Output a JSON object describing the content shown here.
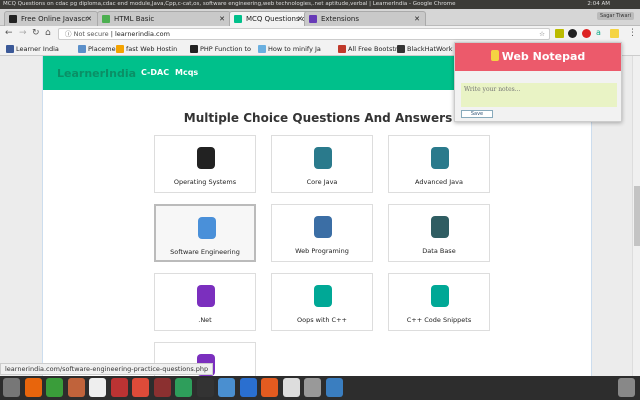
{
  "window_title": "MCQ Questions on cdac pg diploma,cdac end module,Java,Cpp,c-cat,os, software engineering,web technologies,.net aptitude,verbal | LearnerIndia - Google Chrome",
  "clock": "2:04 AM",
  "profile": "Sagar Tiwari",
  "tabs": [
    {
      "label": "Free Online Javascr",
      "color": "#222"
    },
    {
      "label": "HTML Basic",
      "color": "#4caf50"
    },
    {
      "label": "MCQ Questions on",
      "color": "#00c08b"
    },
    {
      "label": "Extensions",
      "color": "#673ab7"
    }
  ],
  "address": {
    "security": "Not secure",
    "url": "learnerindia.com"
  },
  "bookmarks": [
    {
      "label": "Learner India",
      "color": "#3b5998"
    },
    {
      "label": "Placement",
      "color": "#5b8fc9"
    },
    {
      "label": "fast Web Hostin",
      "color": "#f4a300"
    },
    {
      "label": "PHP Function to",
      "color": "#222"
    },
    {
      "label": "How to minify Ja",
      "color": "#6ab0e0"
    },
    {
      "label": "All Free Bootstra",
      "color": "#c0392b"
    },
    {
      "label": "BlackHatWork",
      "color": "#333"
    }
  ],
  "site": {
    "logo": "LearnerIndia",
    "menu": [
      "C-DAC",
      "Mcqs"
    ],
    "heading": "Multiple Choice Questions And Answers"
  },
  "cards": [
    {
      "label": "Operating Systems",
      "icon": "linux-icon",
      "color": "#222"
    },
    {
      "label": "Core Java",
      "icon": "java-icon",
      "color": "#2a7a8c"
    },
    {
      "label": "Advanced Java",
      "icon": "java-icon",
      "color": "#2a7a8c"
    },
    {
      "label": "Software Engineering",
      "icon": "software-engineering-icon",
      "color": "#4a90d9"
    },
    {
      "label": "Web Programing",
      "icon": "web-programming-icon",
      "color": "#3b6ea5"
    },
    {
      "label": "Data Base",
      "icon": "database-icon",
      "color": "#2f5d62"
    },
    {
      "label": ".Net",
      "icon": "visual-studio-icon",
      "color": "#7b2fbe"
    },
    {
      "label": "Oops with C++",
      "icon": "cpp-icon",
      "color": "#00a896"
    },
    {
      "label": "C++ Code Snippets",
      "icon": "cpp-icon",
      "color": "#00a896"
    },
    {
      "label": "",
      "icon": "csharp-icon",
      "color": "#7b2fbe"
    }
  ],
  "status_url": "learnerindia.com/software-engineering-practice-questions.php",
  "notepad": {
    "title": "Web Notepad",
    "placeholder": "Write your notes...",
    "save": "Save"
  },
  "taskbar": [
    "#777",
    "#e8650c",
    "#3a9d3a",
    "#c0633b",
    "#eee",
    "#b33",
    "#dd4b39",
    "#8b3030",
    "#2e9e5b",
    "#333",
    "#4a8fd0",
    "#2a6fd0",
    "#e35b20",
    "#ddd",
    "#999",
    "#3a7ec0"
  ]
}
